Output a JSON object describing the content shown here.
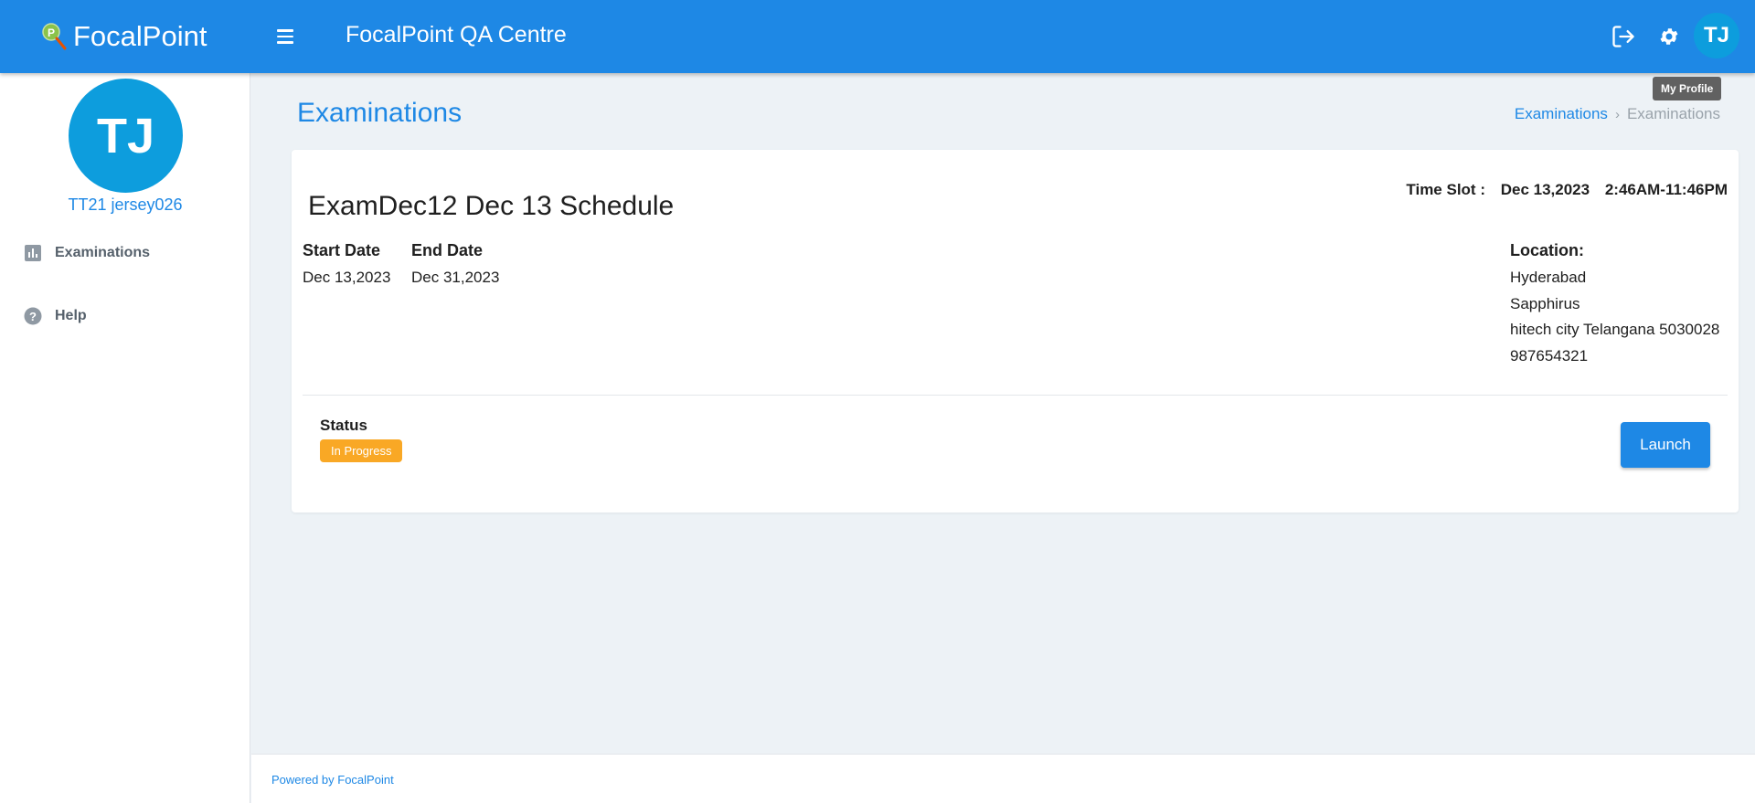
{
  "header": {
    "brand": "FocalPoint",
    "app_title": "FocalPoint QA Centre",
    "avatar_initials": "TJ",
    "tooltip": "My Profile",
    "icons": [
      "menu-icon",
      "logout-icon",
      "gear-icon"
    ]
  },
  "sidebar": {
    "avatar_initials": "TJ",
    "user_name": "TT21 jersey026",
    "items": [
      {
        "label": "Examinations",
        "icon": "bar-chart-icon"
      },
      {
        "label": "Help",
        "icon": "help-circle-icon"
      }
    ]
  },
  "main": {
    "page_title": "Examinations",
    "breadcrumb": {
      "link": "Examinations",
      "current": "Examinations"
    }
  },
  "exam": {
    "title": "ExamDec12 Dec 13 Schedule",
    "time_slot_label": "Time Slot :",
    "time_slot_date": "Dec 13,2023",
    "time_slot_range": "2:46AM-11:46PM",
    "start_date_label": "Start Date",
    "start_date": "Dec 13,2023",
    "end_date_label": "End Date",
    "end_date": "Dec 31,2023",
    "location_label": "Location:",
    "location_lines": [
      "Hyderabad",
      "Sapphirus",
      "hitech city Telangana 5030028",
      "987654321"
    ],
    "status_label": "Status",
    "status_value": "In Progress",
    "launch_label": "Launch"
  },
  "footer": {
    "text": "Powered by FocalPoint"
  },
  "colors": {
    "primary": "#1e88e5",
    "avatar": "#0d9ddd",
    "status_in_progress": "#f9a825"
  }
}
